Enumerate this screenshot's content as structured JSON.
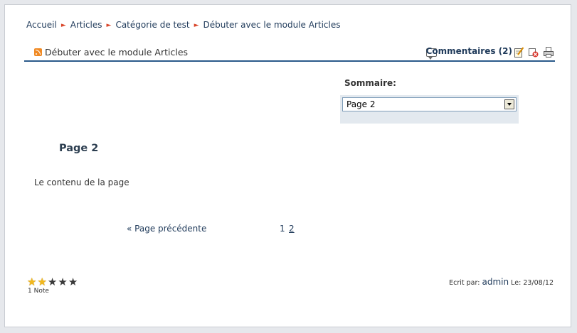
{
  "breadcrumb": {
    "items": [
      "Accueil",
      "Articles",
      "Catégorie de test",
      "Débuter avec le module Articles"
    ],
    "separator": "►"
  },
  "article": {
    "title": "Débuter avec le module Articles",
    "comments_label": "Commentaires (2)"
  },
  "summary": {
    "label": "Sommaire:",
    "selected": "Page 2"
  },
  "content": {
    "page_heading": "Page 2",
    "text": "Le contenu de la page"
  },
  "pagination": {
    "prev_label": "« Page précédente",
    "pages": [
      "1",
      "2"
    ],
    "current": "2"
  },
  "rating": {
    "value": 2,
    "max": 5,
    "votes_label": "1 Note"
  },
  "footer": {
    "written_by_label": "Ecrit par:",
    "author": "admin",
    "date_label": "Le:",
    "date": "23/08/12"
  },
  "colors": {
    "accent": "#2a5a8a",
    "link": "#1f3a5a",
    "separator": "#d9472b",
    "rss": "#f08a24",
    "star_on": "#f2b81d"
  }
}
